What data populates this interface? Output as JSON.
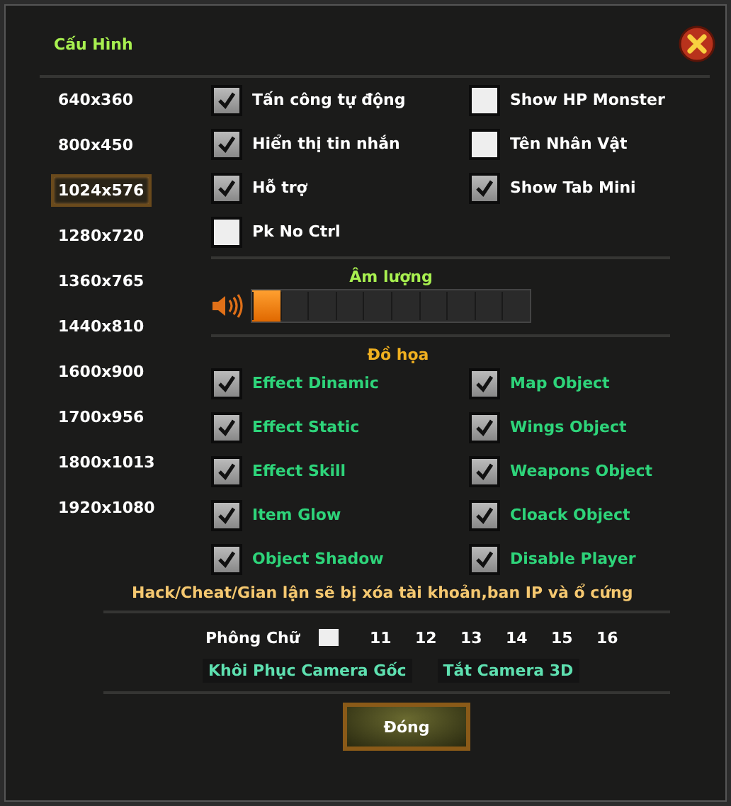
{
  "window": {
    "title": "Cấu Hình"
  },
  "resolutions": [
    {
      "label": "640x360",
      "selected": false
    },
    {
      "label": "800x450",
      "selected": false
    },
    {
      "label": "1024x576",
      "selected": true
    },
    {
      "label": "1280x720",
      "selected": false
    },
    {
      "label": "1360x765",
      "selected": false
    },
    {
      "label": "1440x810",
      "selected": false
    },
    {
      "label": "1600x900",
      "selected": false
    },
    {
      "label": "1700x956",
      "selected": false
    },
    {
      "label": "1800x1013",
      "selected": false
    },
    {
      "label": "1920x1080",
      "selected": false
    }
  ],
  "options": [
    {
      "label": "Tấn công tự động",
      "checked": true
    },
    {
      "label": "Show HP Monster",
      "checked": false
    },
    {
      "label": "Hiển thị tin nhắn",
      "checked": true
    },
    {
      "label": "Tên Nhân Vật",
      "checked": false
    },
    {
      "label": "Hỗ trợ",
      "checked": true
    },
    {
      "label": "Show Tab Mini",
      "checked": true
    },
    {
      "label": "Pk No Ctrl",
      "checked": false
    }
  ],
  "volume": {
    "title": "Âm lượng",
    "level": 0.1
  },
  "graphics": {
    "title": "Đồ họa",
    "items": [
      {
        "label": "Effect Dinamic",
        "checked": true
      },
      {
        "label": "Map Object",
        "checked": true
      },
      {
        "label": "Effect Static",
        "checked": true
      },
      {
        "label": "Wings Object",
        "checked": true
      },
      {
        "label": "Effect Skill",
        "checked": true
      },
      {
        "label": "Weapons Object",
        "checked": true
      },
      {
        "label": "Item Glow",
        "checked": true
      },
      {
        "label": "Cloack Object",
        "checked": true
      },
      {
        "label": "Object Shadow",
        "checked": true
      },
      {
        "label": "Disable Player",
        "checked": true
      }
    ]
  },
  "warning": "Hack/Cheat/Gian lận sẽ bị xóa tài khoản,ban IP và ổ cứng",
  "font": {
    "label": "Phông Chữ",
    "sizes": [
      "11",
      "12",
      "13",
      "14",
      "15",
      "16"
    ]
  },
  "camera_buttons": [
    "Khôi Phục Camera Gốc",
    "Tắt Camera 3D"
  ],
  "close_button": "Đóng"
}
